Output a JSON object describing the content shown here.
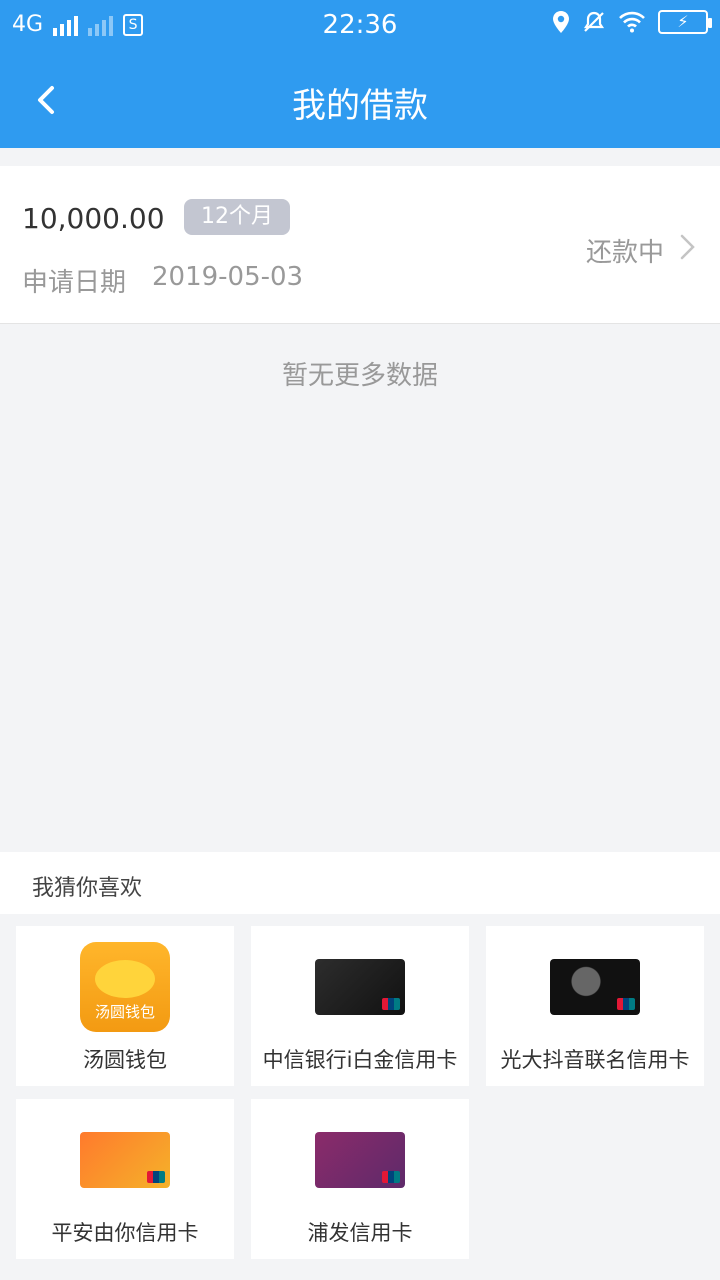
{
  "status_bar": {
    "network": "4G",
    "time": "22:36",
    "sim_label": "S"
  },
  "nav": {
    "title": "我的借款"
  },
  "loan": {
    "amount": "10,000.00",
    "term": "12个月",
    "date_label": "申请日期",
    "date_value": "2019-05-03",
    "status": "还款中"
  },
  "empty_text": "暂无更多数据",
  "recommend": {
    "title": "我猜你喜欢",
    "items": [
      {
        "label": "汤圆钱包",
        "icon_text": "汤圆钱包"
      },
      {
        "label": "中信银行i白金信用卡"
      },
      {
        "label": "光大抖音联名信用卡"
      },
      {
        "label": "平安由你信用卡"
      },
      {
        "label": "浦发信用卡"
      }
    ]
  },
  "colors": {
    "header": "#2f9bf0",
    "badge": "#c3c6d1",
    "background": "#f3f4f6"
  }
}
